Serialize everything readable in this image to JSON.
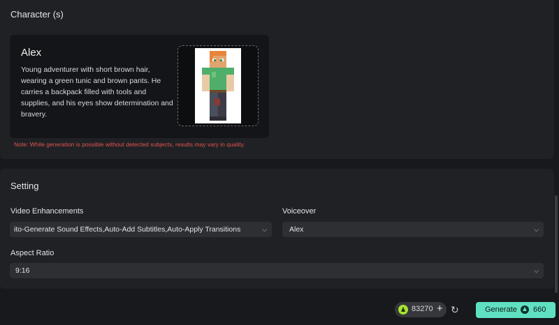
{
  "characters": {
    "title": "Character (s)",
    "card": {
      "name": "Alex",
      "description": "Young adventurer with short brown hair, wearing a green tunic and brown pants. He carries a backpack filled with tools and supplies, and his eyes show determination and bravery."
    },
    "note": "Note: While generation is possible without detected subjects, results may vary in quality."
  },
  "settings": {
    "title": "Setting",
    "video_enhancements": {
      "label": "Video Enhancements",
      "value": "ito-Generate Sound Effects,Auto-Add Subtitles,Auto-Apply Transitions"
    },
    "voiceover": {
      "label": "Voiceover",
      "value": "Alex"
    },
    "aspect_ratio": {
      "label": "Aspect Ratio",
      "value": "9:16"
    }
  },
  "footer": {
    "credits": "83270",
    "generate_label": "Generate",
    "generate_cost": "660"
  },
  "colors": {
    "accent": "#5fe0c1",
    "credit_coin": "#a6e22e",
    "note": "#e2534e"
  },
  "icons": {
    "credit": "arrow-up-coin-icon",
    "add": "plus-icon",
    "refresh": "refresh-icon",
    "dropdown": "chevron-down-icon"
  }
}
